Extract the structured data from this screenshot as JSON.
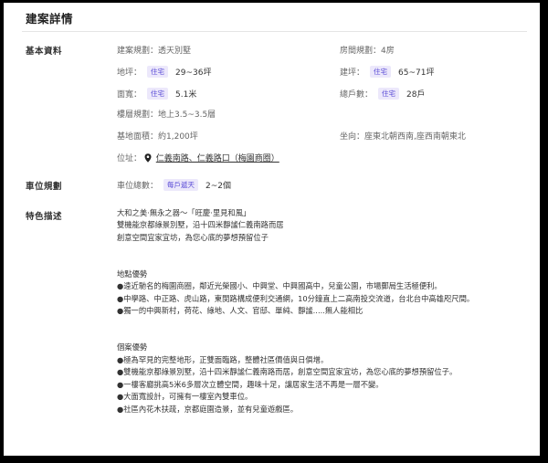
{
  "title": "建案詳情",
  "basic": {
    "section_label": "基本資料",
    "planning": "建案規劃：透天別墅",
    "rooms": "房間規劃：4房",
    "land_label": "地坪：",
    "land_tag": "住宅",
    "land_value": "29~36坪",
    "building_label": "建坪：",
    "building_tag": "住宅",
    "building_value": "65~71坪",
    "frontage_label": "面寬：",
    "frontage_tag": "住宅",
    "frontage_value": "5.1米",
    "households_label": "總戶數：",
    "households_tag": "住宅",
    "households_value": "28戶",
    "floors": "樓層規劃：地上3.5~3.5層",
    "base_area": "基地面積：約1,200坪",
    "orientation": "坐向：座東北朝西南,座西南朝東北",
    "location_label": "位址：",
    "location_value": "仁義南路、仁義路口（梅園商圈）"
  },
  "parking": {
    "section_label": "車位規劃",
    "total_label": "車位總數：",
    "tag": "每戶遞天",
    "value": "2~2個"
  },
  "features": {
    "section_label": "特色描述",
    "lines": [
      "大和之美‧無永之器～「旺慶‧里見和風」",
      "雙機能京都綠景別墅，沿十四米靜謐仁義南路而居",
      "創意空間宜家宜坊，為您心底的夢想預留位子",
      "",
      "",
      "地點優勢",
      "●遠近馳名的梅園商圈，鄰近光榮國小、中興堂、中興國高中，兒童公園，市場郵局生活極便利。",
      "●中學路、中正路、虎山路，東閔路構成便利交通網，10分鐘直上二高南投交流道，台北台中高雄咫尺間。",
      "●獨一的中興新村，荷花、綠地、人文、官邸、單純、靜謐.....無人能相比",
      "",
      "",
      "個案優勢",
      "●極為罕見的完整地形，正雙面臨路，整體社區價值與日俱增。",
      "●雙機能京都綠景別墅，沿十四米靜謐仁義南路而居，創意空間宜家宜坊，為您心底的夢想預留位子。",
      "●一樓客廳挑高5米6多層次立體空間，趣味十足，讓居家生活不再是一層不變。",
      "●大面寬設計，可擁有一樓室內雙車位。",
      "●社區內花木扶疏，京都庭園造景，並有兒童遊戲區。"
    ]
  }
}
